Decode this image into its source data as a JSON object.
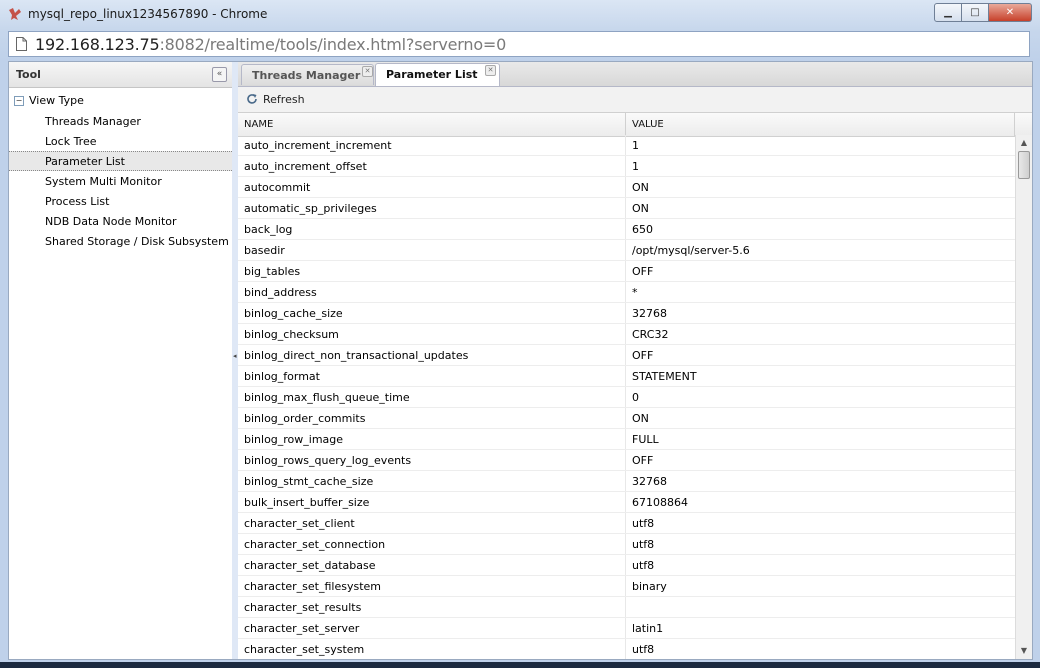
{
  "window": {
    "title": "mysql_repo_linux1234567890 - Chrome",
    "url_host": "192.168.123.75",
    "url_rest": ":8082/realtime/tools/index.html?serverno=0"
  },
  "tool_panel": {
    "title": "Tool",
    "collapse_glyph": "«",
    "root_label": "View Type",
    "items": [
      {
        "label": "Threads Manager"
      },
      {
        "label": "Lock Tree"
      },
      {
        "label": "Parameter List"
      },
      {
        "label": "System Multi Monitor"
      },
      {
        "label": "Process List"
      },
      {
        "label": "NDB Data Node Monitor"
      },
      {
        "label": "Shared Storage / Disk Subsystem"
      }
    ],
    "selected_index": 2
  },
  "tabs": [
    {
      "label": "Threads Manager",
      "active": false
    },
    {
      "label": "Parameter List",
      "active": true
    }
  ],
  "toolbar": {
    "refresh_label": "Refresh"
  },
  "grid": {
    "columns": {
      "name": "NAME",
      "value": "VALUE"
    },
    "rows": [
      {
        "name": "auto_increment_increment",
        "value": "1"
      },
      {
        "name": "auto_increment_offset",
        "value": "1"
      },
      {
        "name": "autocommit",
        "value": "ON"
      },
      {
        "name": "automatic_sp_privileges",
        "value": "ON"
      },
      {
        "name": "back_log",
        "value": "650"
      },
      {
        "name": "basedir",
        "value": "/opt/mysql/server-5.6"
      },
      {
        "name": "big_tables",
        "value": "OFF"
      },
      {
        "name": "bind_address",
        "value": "*"
      },
      {
        "name": "binlog_cache_size",
        "value": "32768"
      },
      {
        "name": "binlog_checksum",
        "value": "CRC32"
      },
      {
        "name": "binlog_direct_non_transactional_updates",
        "value": "OFF"
      },
      {
        "name": "binlog_format",
        "value": "STATEMENT"
      },
      {
        "name": "binlog_max_flush_queue_time",
        "value": "0"
      },
      {
        "name": "binlog_order_commits",
        "value": "ON"
      },
      {
        "name": "binlog_row_image",
        "value": "FULL"
      },
      {
        "name": "binlog_rows_query_log_events",
        "value": "OFF"
      },
      {
        "name": "binlog_stmt_cache_size",
        "value": "32768"
      },
      {
        "name": "bulk_insert_buffer_size",
        "value": "67108864"
      },
      {
        "name": "character_set_client",
        "value": "utf8"
      },
      {
        "name": "character_set_connection",
        "value": "utf8"
      },
      {
        "name": "character_set_database",
        "value": "utf8"
      },
      {
        "name": "character_set_filesystem",
        "value": "binary"
      },
      {
        "name": "character_set_results",
        "value": ""
      },
      {
        "name": "character_set_server",
        "value": "latin1"
      },
      {
        "name": "character_set_system",
        "value": "utf8"
      }
    ]
  }
}
